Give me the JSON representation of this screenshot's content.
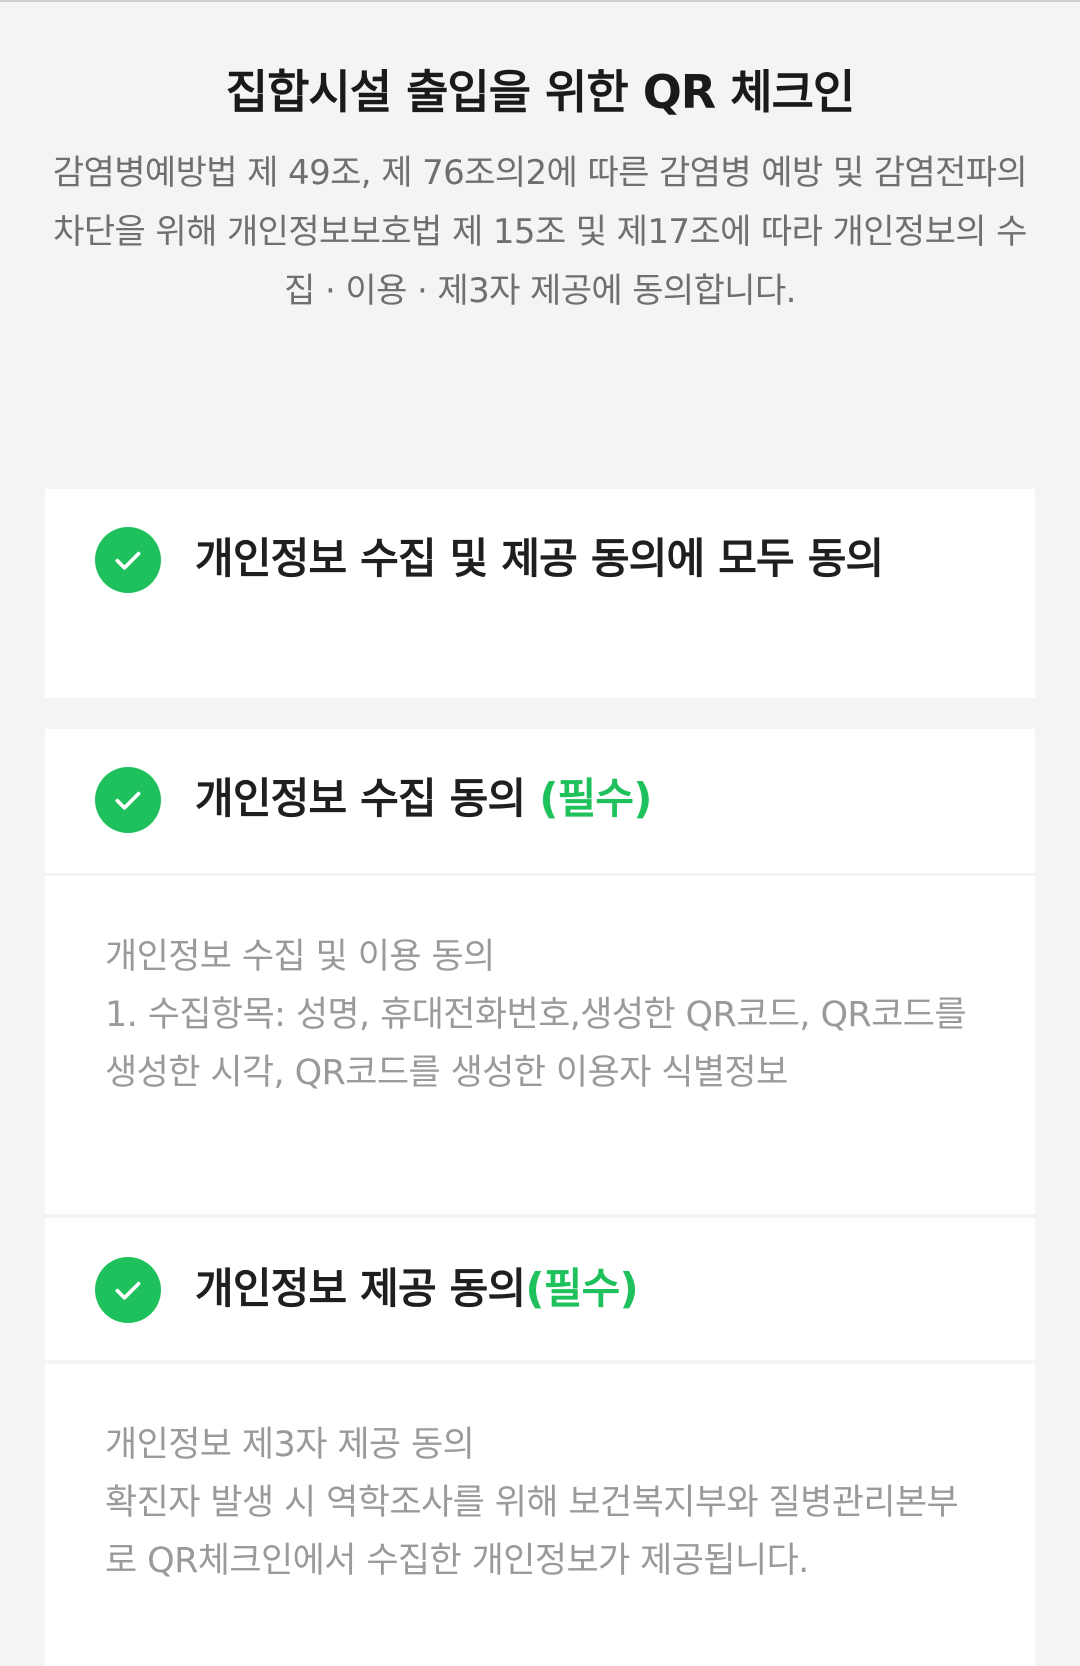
{
  "title": "집합시설 출입을 위한 QR 체크인",
  "intro": "감염병예방법 제 49조, 제 76조의2에 따른 감염병 예방 및 감염전파의 차단을 위해 개인정보보호법 제 15조 및 제17조에 따라 개인정보의 수집 · 이용 · 제3자 제공에 동의합니다.",
  "agree_all": {
    "label": "개인정보 수집 및 제공 동의에 모두 동의",
    "checked": true
  },
  "consents": [
    {
      "label": "개인정보 수집 동의 ",
      "required": "(필수)",
      "checked": true,
      "detail_title": "개인정보 수집 및 이용 동의",
      "detail_body": "1. 수집항목: 성명, 휴대전화번호,생성한 QR코드, QR코드를 생성한 시각, QR코드를 생성한 이용자 식별정보"
    },
    {
      "label": "개인정보 제공 동의",
      "required": "(필수)",
      "checked": true,
      "detail_title": "개인정보 제3자 제공 동의",
      "detail_body": "확진자 발생 시 역학조사를 위해 보건복지부와 질병관리본부로 QR체크인에서 수집한 개인정보가 제공됩니다."
    }
  ],
  "colors": {
    "accent": "#1fc15c",
    "background": "#f4f4f6",
    "card": "#ffffff",
    "muted_text": "#9a9a9a"
  },
  "icons": {
    "check": "check-circle-icon"
  }
}
